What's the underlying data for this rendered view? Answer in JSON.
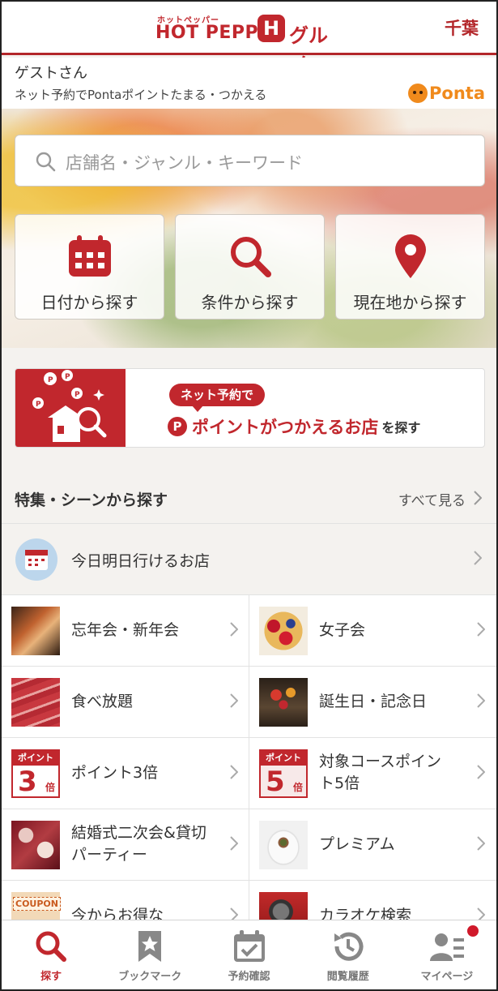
{
  "colors": {
    "brand_red": "#c1272d",
    "ponta_orange": "#f08a1c",
    "text": "#333333",
    "muted": "#9a9a9a"
  },
  "header": {
    "logo_small": "ホットペッパー",
    "logo_main": "HOT PEPPER",
    "logo_mark": "H",
    "logo_gourmet": "グルメ",
    "region": "千葉"
  },
  "guest": {
    "name": "ゲストさん",
    "subtitle": "ネット予約でPontaポイントたまる・つかえる",
    "ponta_logo": "Ponta"
  },
  "search": {
    "placeholder": "店舗名・ジャンル・キーワード",
    "icon": "search-icon"
  },
  "quick_search": [
    {
      "label": "日付から探す",
      "icon": "calendar-icon"
    },
    {
      "label": "条件から探す",
      "icon": "magnifier-icon"
    },
    {
      "label": "現在地から探す",
      "icon": "location-pin-icon"
    }
  ],
  "banner": {
    "pill": "ネット予約で",
    "point_mark": "P",
    "main": "ポイントがつかえるお店",
    "suffix": "を探す"
  },
  "section": {
    "title": "特集・シーンから探す",
    "see_all": "すべて見る"
  },
  "features": {
    "full_row": {
      "label": "今日明日行けるお店",
      "icon": "calendar-icon"
    },
    "grid": [
      {
        "label": "忘年会・新年会",
        "thumb": "party-food-photo"
      },
      {
        "label": "女子会",
        "thumb": "fruit-tart-photo"
      },
      {
        "label": "食べ放題",
        "thumb": "meat-photo"
      },
      {
        "label": "誕生日・記念日",
        "thumb": "flowers-photo"
      },
      {
        "label": "ポイント3倍",
        "badge_top": "ポイント",
        "badge_num": "3",
        "badge_unit": "倍"
      },
      {
        "label": "対象コースポイント5倍",
        "badge_top": "ポイント",
        "badge_num": "5",
        "badge_unit": "倍"
      },
      {
        "label": "結婚式二次会&貸切パーティー",
        "thumb": "wedding-photo"
      },
      {
        "label": "プレミアム",
        "thumb": "premium-dish-photo"
      },
      {
        "label": "今からお得な",
        "coupon_text": "COUPON"
      },
      {
        "label": "カラオケ検索",
        "thumb": "microphone-photo"
      }
    ]
  },
  "tabbar": [
    {
      "label": "探す",
      "icon": "search-icon",
      "active": true
    },
    {
      "label": "ブックマーク",
      "icon": "bookmark-icon",
      "active": false
    },
    {
      "label": "予約確認",
      "icon": "reservation-calendar-icon",
      "active": false
    },
    {
      "label": "閲覧履歴",
      "icon": "history-icon",
      "active": false
    },
    {
      "label": "マイページ",
      "icon": "user-icon",
      "active": false
    }
  ]
}
